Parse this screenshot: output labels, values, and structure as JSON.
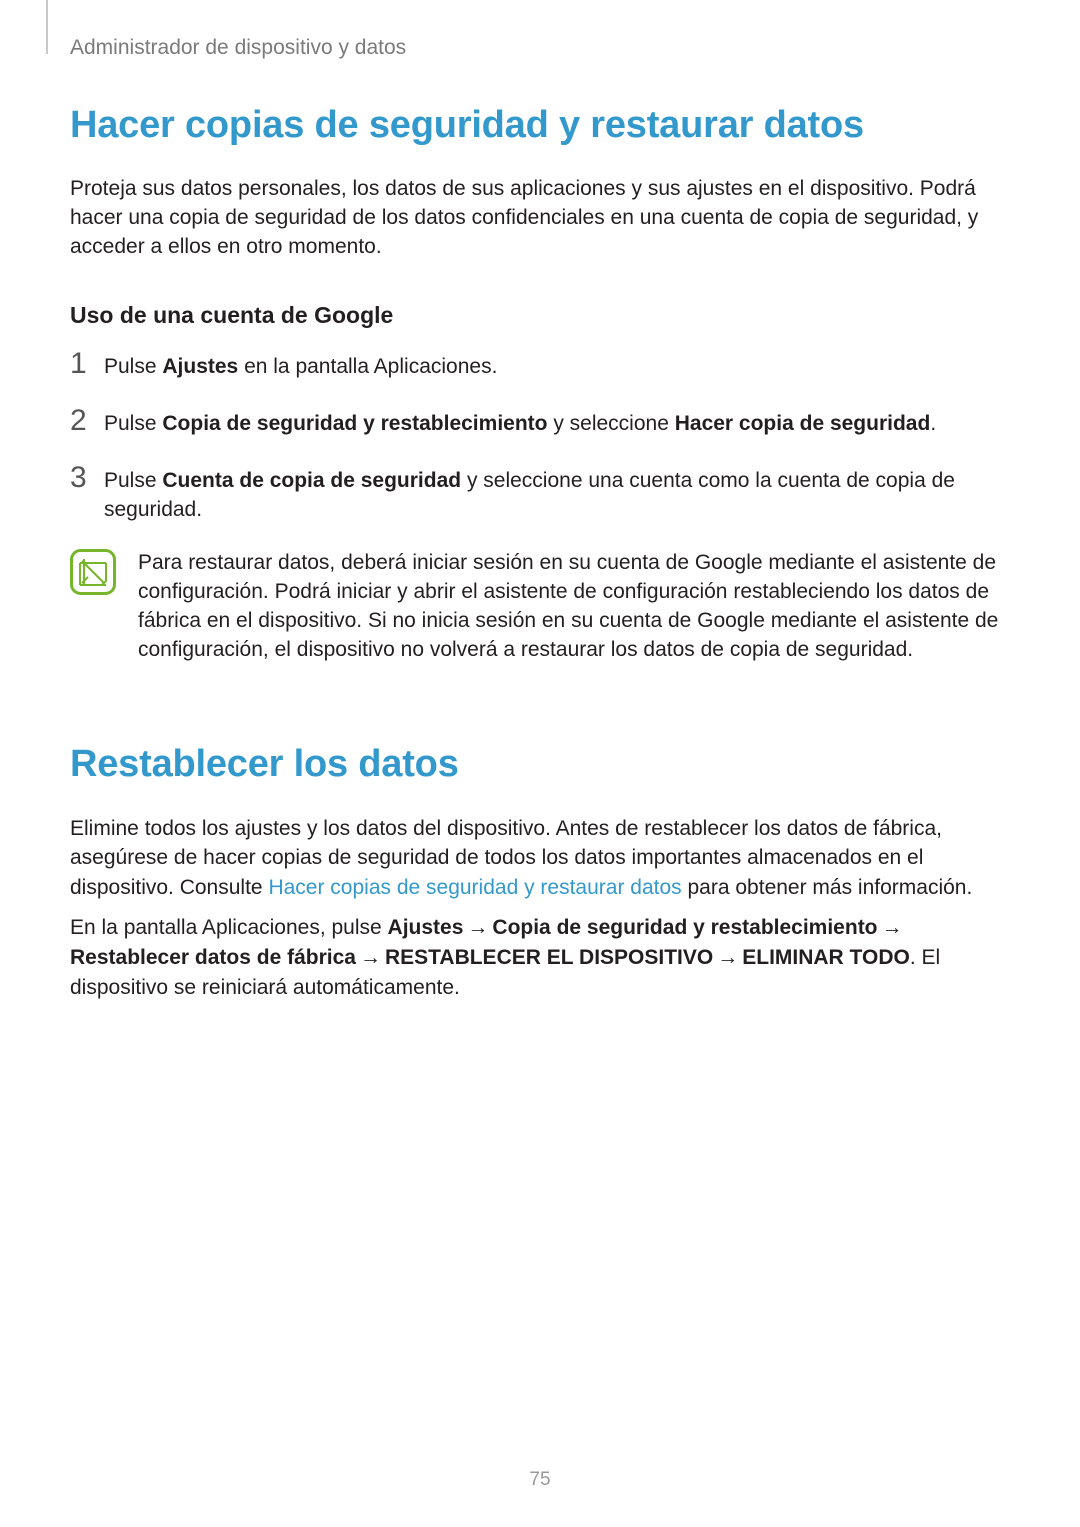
{
  "header": "Administrador de dispositivo y datos",
  "h1_backup": "Hacer copias de seguridad y restaurar datos",
  "intro": "Proteja sus datos personales, los datos de sus aplicaciones y sus ajustes en el dispositivo. Podrá hacer una copia de seguridad de los datos confidenciales en una cuenta de copia de seguridad, y acceder a ellos en otro momento.",
  "h2_google": "Uso de una cuenta de Google",
  "steps": {
    "s1_num": "1",
    "s1_a": "Pulse ",
    "s1_b": "Ajustes",
    "s1_c": " en la pantalla Aplicaciones.",
    "s2_num": "2",
    "s2_a": "Pulse ",
    "s2_b": "Copia de seguridad y restablecimiento",
    "s2_c": " y seleccione ",
    "s2_d": "Hacer copia de seguridad",
    "s2_e": ".",
    "s3_num": "3",
    "s3_a": "Pulse ",
    "s3_b": "Cuenta de copia de seguridad",
    "s3_c": " y seleccione una cuenta como la cuenta de copia de seguridad."
  },
  "note": "Para restaurar datos, deberá iniciar sesión en su cuenta de Google mediante el asistente de configuración. Podrá iniciar y abrir el asistente de configuración restableciendo los datos de fábrica en el dispositivo. Si no inicia sesión en su cuenta de Google mediante el asistente de configuración, el dispositivo no volverá a restaurar los datos de copia de seguridad.",
  "h1_reset": "Restablecer los datos",
  "reset": {
    "p1_a": "Elimine todos los ajustes y los datos del dispositivo. Antes de restablecer los datos de fábrica, asegúrese de hacer copias de seguridad de todos los datos importantes almacenados en el dispositivo. Consulte ",
    "p1_link": "Hacer copias de seguridad y restaurar datos",
    "p1_b": " para obtener más información.",
    "p2_a": "En la pantalla Aplicaciones, pulse ",
    "p2_b": "Ajustes",
    "p2_arrow": "→",
    "p2_c": "Copia de seguridad y restablecimiento",
    "p2_d": "Restablecer datos de fábrica",
    "p2_e": "RESTABLECER EL DISPOSITIVO",
    "p2_f": "ELIMINAR TODO",
    "p2_g": ". El dispositivo se reiniciará automáticamente."
  },
  "page_number": "75"
}
